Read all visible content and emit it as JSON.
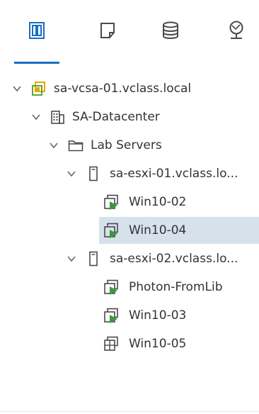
{
  "colors": {
    "accent": "#1b6ec2",
    "selection": "#d7e1eb",
    "vm_green": "#3a9a3a",
    "vcenter_yellow": "#e2a800",
    "vcenter_green": "#5ba63a",
    "icon_gray": "#4a4a4a"
  },
  "tabs": [
    {
      "name": "hosts-and-clusters",
      "icon": "hosts-clusters-icon",
      "active": true
    },
    {
      "name": "vms-and-templates",
      "icon": "vms-templates-icon",
      "active": false
    },
    {
      "name": "storage",
      "icon": "database-icon",
      "active": false
    },
    {
      "name": "networking",
      "icon": "network-icon",
      "active": false
    }
  ],
  "tree": [
    {
      "label": "sa-vcsa-01.vclass.local",
      "icon": "vcenter-icon",
      "depth": 0,
      "expanded": true
    },
    {
      "label": "SA-Datacenter",
      "icon": "datacenter-icon",
      "depth": 1,
      "expanded": true
    },
    {
      "label": "Lab Servers",
      "icon": "folder-icon",
      "depth": 2,
      "expanded": true
    },
    {
      "label": "sa-esxi-01.vclass.lo...",
      "icon": "host-icon",
      "depth": 3,
      "expanded": true
    },
    {
      "label": "Win10-02",
      "icon": "vm-powered-on-icon",
      "depth": 4
    },
    {
      "label": "Win10-04",
      "icon": "vm-powered-on-icon",
      "depth": 4,
      "selected": true
    },
    {
      "label": "sa-esxi-02.vclass.lo...",
      "icon": "host-icon",
      "depth": 3,
      "expanded": true
    },
    {
      "label": "Photon-FromLib",
      "icon": "vm-powered-on-icon",
      "depth": 4
    },
    {
      "label": "Win10-03",
      "icon": "vm-powered-on-icon",
      "depth": 4
    },
    {
      "label": "Win10-05",
      "icon": "vm-powered-off-icon",
      "depth": 4
    }
  ]
}
